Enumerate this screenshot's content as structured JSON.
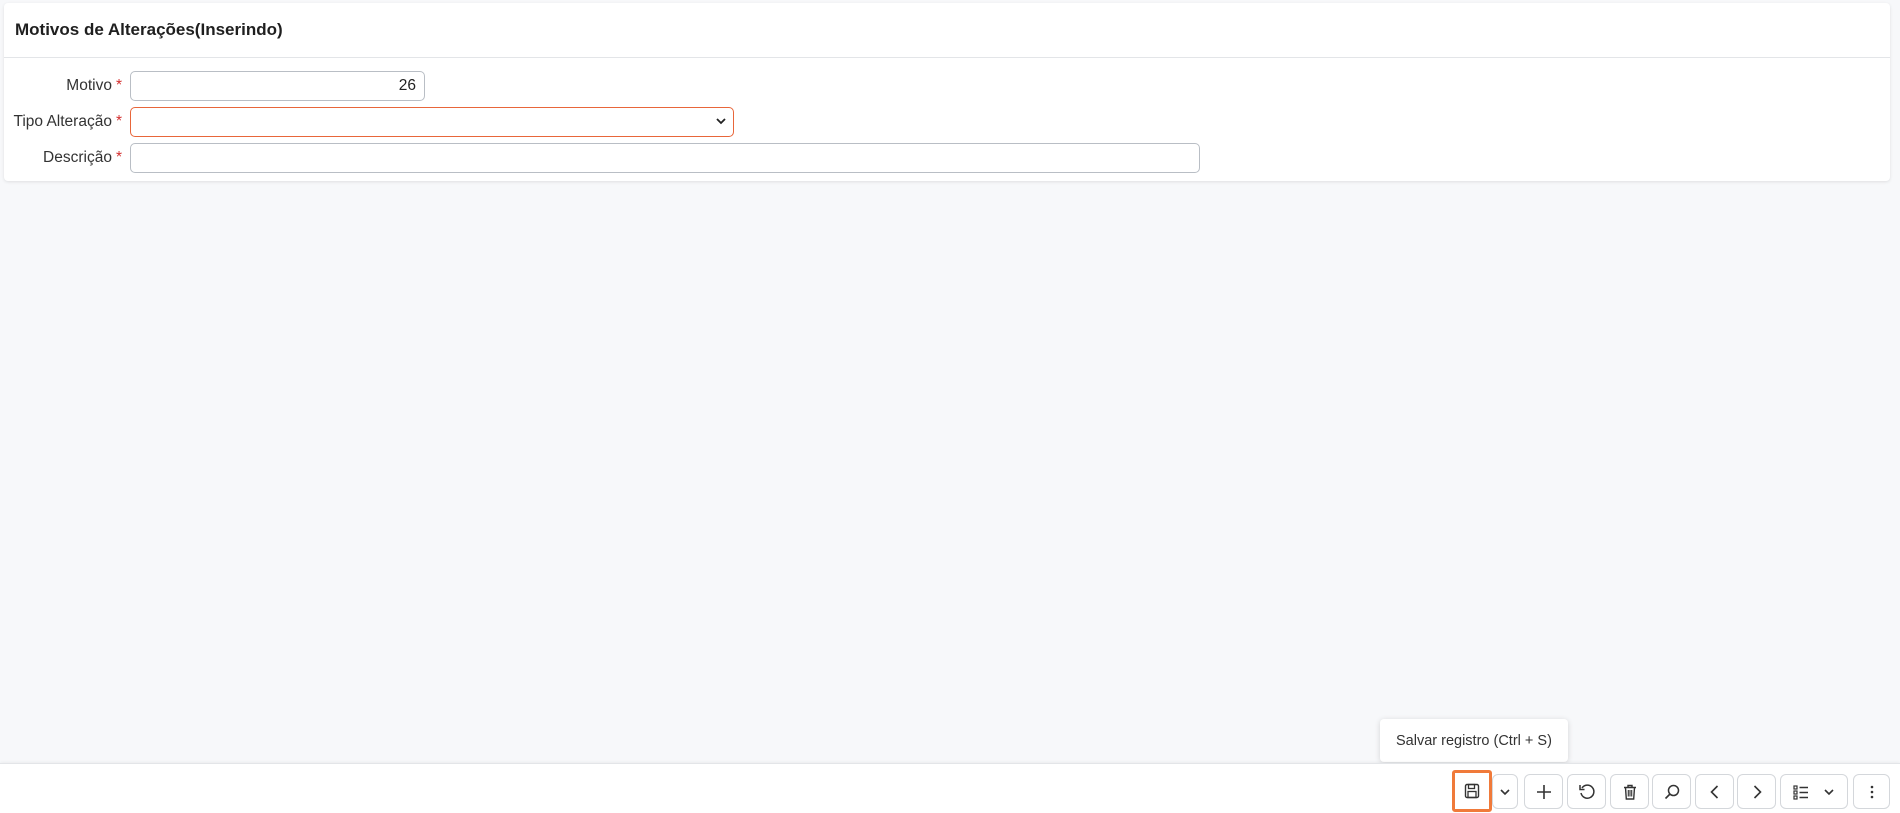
{
  "header": {
    "title": "Motivos de Alterações(Inserindo)"
  },
  "form": {
    "motivo": {
      "label": "Motivo",
      "required": "*",
      "value": "26"
    },
    "tipo_alteracao": {
      "label": "Tipo Alteração",
      "required": "*",
      "value": "",
      "state": "error"
    },
    "descricao": {
      "label": "Descrição",
      "required": "*",
      "value": ""
    }
  },
  "toolbar": {
    "tooltip": "Salvar registro (Ctrl + S)",
    "buttons": [
      {
        "name": "save",
        "icon": "floppy-disk-icon",
        "highlighted": true
      },
      {
        "name": "save-options",
        "icon": "chevron-down-icon"
      },
      {
        "name": "add",
        "icon": "plus-icon"
      },
      {
        "name": "refresh",
        "icon": "refresh-icon"
      },
      {
        "name": "delete",
        "icon": "trash-icon"
      },
      {
        "name": "search",
        "icon": "search-icon"
      },
      {
        "name": "previous",
        "icon": "chevron-left-icon"
      },
      {
        "name": "next",
        "icon": "chevron-right-icon"
      },
      {
        "name": "list-view",
        "icon": "list-icon"
      },
      {
        "name": "more",
        "icon": "kebab-menu-icon"
      }
    ]
  },
  "colors": {
    "highlight": "#f07a3a",
    "required": "#d32f2f",
    "error_border": "#e8663a"
  }
}
